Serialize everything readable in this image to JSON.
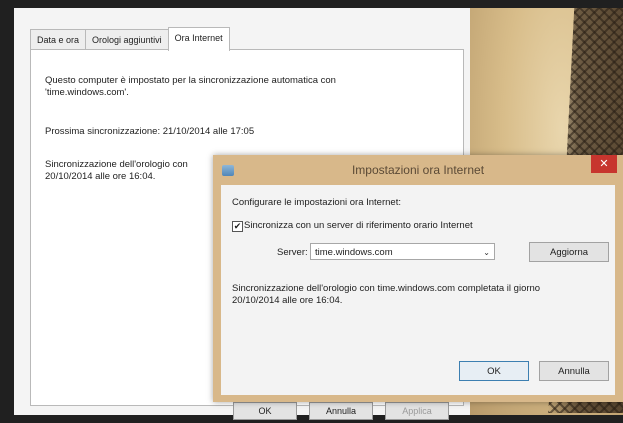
{
  "main": {
    "tabs": [
      {
        "label": "Data e ora"
      },
      {
        "label": "Orologi aggiuntivi"
      },
      {
        "label": "Ora Internet"
      }
    ],
    "sync_line1": "Questo computer è impostato per la sincronizzazione automatica con",
    "sync_line2": "'time.windows.com'.",
    "next_sync": "Prossima sincronizzazione: 21/10/2014 alle 17:05",
    "last_sync_line1": "Sincronizzazione dell'orologio con",
    "last_sync_line2": "20/10/2014 alle ore 16:04.",
    "ok_label": "OK",
    "cancel_label": "Annulla",
    "apply_label": "Applica"
  },
  "net_dialog": {
    "title": "Impostazioni ora Internet",
    "close_glyph": "✕",
    "configure_label": "Configurare le impostazioni ora Internet:",
    "sync_checkbox_label": "Sincronizza con un server di riferimento orario Internet",
    "sync_checkbox_checked": true,
    "check_glyph": "✔",
    "server_label": "Server:",
    "server_value": "time.windows.com",
    "chevron_glyph": "⌄",
    "update_label": "Aggiorna",
    "status_line1": "Sincronizzazione dell'orologio con time.windows.com completata il giorno",
    "status_line2": "20/10/2014 alle ore 16:04.",
    "ok_label": "OK",
    "cancel_label": "Annulla"
  }
}
